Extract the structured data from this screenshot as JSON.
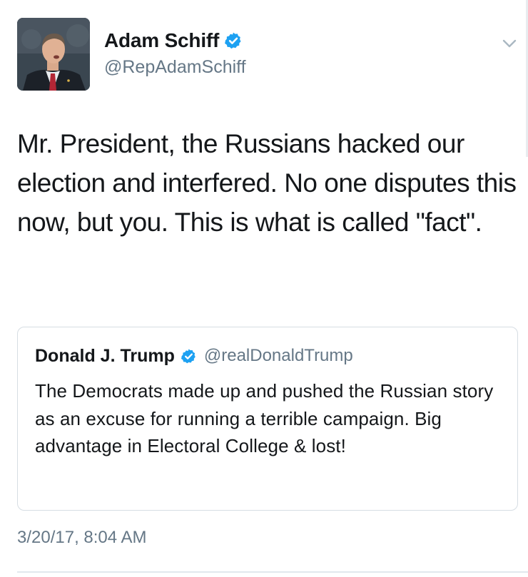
{
  "author": {
    "display_name": "Adam Schiff",
    "handle": "@RepAdamSchiff",
    "verified": true
  },
  "tweet": {
    "text": "Mr. President, the Russians hacked our election and interfered. No one disputes this now, but you. This is what is called \"fact\".",
    "timestamp": "3/20/17, 8:04 AM"
  },
  "quoted_tweet": {
    "display_name": "Donald J. Trump",
    "handle": "@realDonaldTrump",
    "verified": true,
    "text": "The Democrats made up and pushed the Russian story as an excuse for running a terrible campaign. Big advantage in Electoral College & lost!"
  },
  "icons": {
    "verified": "verified-badge-icon",
    "menu": "chevron-down-icon"
  },
  "colors": {
    "verified_blue": "#1da1f2",
    "secondary_text": "#657786",
    "border": "#d6dde3"
  }
}
